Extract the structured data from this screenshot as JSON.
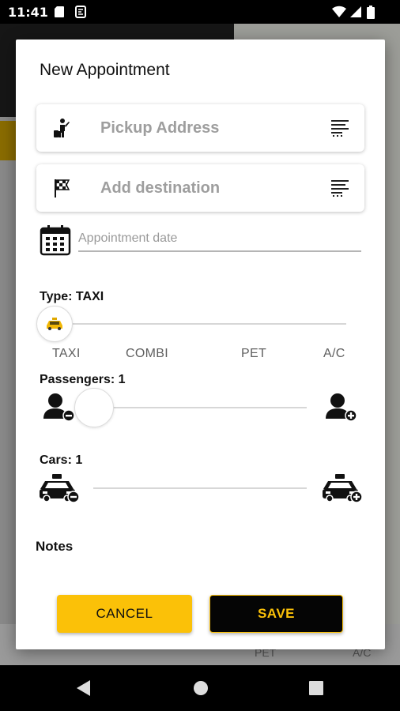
{
  "status_bar": {
    "time": "11:41",
    "icons": [
      "sd-card-icon",
      "sim-icon",
      "wifi-icon",
      "signal-icon",
      "battery-icon"
    ]
  },
  "background": {
    "bottom_labels": [
      "PET",
      "A/C"
    ]
  },
  "dialog": {
    "title": "New Appointment",
    "pickup": {
      "placeholder": "Pickup Address",
      "icon": "person-hailing-icon",
      "action_icon": "list-icon"
    },
    "destination": {
      "placeholder": "Add destination",
      "icon": "checkered-flag-icon",
      "action_icon": "list-icon"
    },
    "date": {
      "placeholder": "Appointment date",
      "value": "",
      "icon": "calendar-icon"
    },
    "type": {
      "label": "Type: TAXI",
      "options": [
        "TAXI",
        "COMBI",
        "PET",
        "A/C"
      ],
      "selected": "TAXI",
      "selected_index": 0,
      "icon": "taxi-icon"
    },
    "passengers": {
      "label": "Passengers: 1",
      "value": 1,
      "decrease_icon": "person-minus-icon",
      "increase_icon": "person-plus-icon"
    },
    "cars": {
      "label": "Cars: 1",
      "value": 1,
      "decrease_icon": "taxi-minus-icon",
      "increase_icon": "taxi-plus-icon"
    },
    "notes_label": "Notes",
    "cancel_label": "CANCEL",
    "save_label": "SAVE"
  },
  "colors": {
    "accent": "#fbc108",
    "dark": "#050505",
    "placeholder": "#9e9e9e"
  },
  "nav_bar": {
    "buttons": [
      "back-icon",
      "home-icon",
      "recents-icon"
    ]
  }
}
